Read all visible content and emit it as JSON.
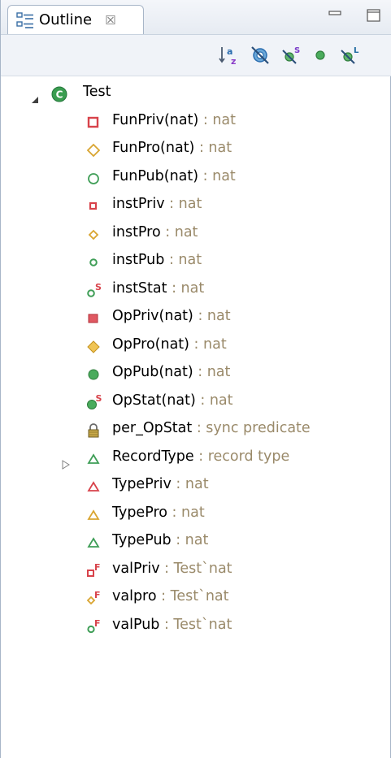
{
  "view": {
    "tab_title": "Outline",
    "tab_close_symbol": "☒"
  },
  "toolbar": {
    "buttons": [
      {
        "name": "sort-alphabetically-icon"
      },
      {
        "name": "hide-fields-icon"
      },
      {
        "name": "hide-static-members-icon"
      },
      {
        "name": "hide-non-public-members-icon"
      },
      {
        "name": "hide-local-types-icon"
      }
    ]
  },
  "tree": {
    "root": {
      "name": "Test",
      "expanded": true
    },
    "items": [
      {
        "name": "FunPriv(nat)",
        "sep": " : ",
        "type": "nat"
      },
      {
        "name": "FunPro(nat)",
        "sep": " : ",
        "type": "nat"
      },
      {
        "name": "FunPub(nat)",
        "sep": " : ",
        "type": "nat"
      },
      {
        "name": "instPriv",
        "sep": " : ",
        "type": "nat"
      },
      {
        "name": "instPro",
        "sep": " : ",
        "type": "nat"
      },
      {
        "name": "instPub",
        "sep": " : ",
        "type": "nat"
      },
      {
        "name": "instStat",
        "sep": " : ",
        "type": "nat"
      },
      {
        "name": "OpPriv(nat)",
        "sep": " : ",
        "type": "nat"
      },
      {
        "name": "OpPro(nat)",
        "sep": " : ",
        "type": "nat"
      },
      {
        "name": "OpPub(nat)",
        "sep": " : ",
        "type": "nat"
      },
      {
        "name": "OpStat(nat)",
        "sep": " : ",
        "type": "nat"
      },
      {
        "name": "per_OpStat",
        "sep": " : ",
        "type": "sync predicate"
      },
      {
        "name": "RecordType",
        "sep": " : ",
        "type": "record type",
        "expandable": true
      },
      {
        "name": "TypePriv",
        "sep": " : ",
        "type": "nat"
      },
      {
        "name": "TypePro",
        "sep": " : ",
        "type": "nat"
      },
      {
        "name": "TypePub",
        "sep": " : ",
        "type": "nat"
      },
      {
        "name": "valPriv",
        "sep": " : ",
        "type": "Test`nat"
      },
      {
        "name": "valpro",
        "sep": " : ",
        "type": "Test`nat"
      },
      {
        "name": "valPub",
        "sep": " : ",
        "type": "Test`nat"
      }
    ]
  },
  "colors": {
    "private": "#d8434b",
    "protected": "#d9a531",
    "public": "#3f9e57",
    "type_text": "#9a8a6a"
  }
}
